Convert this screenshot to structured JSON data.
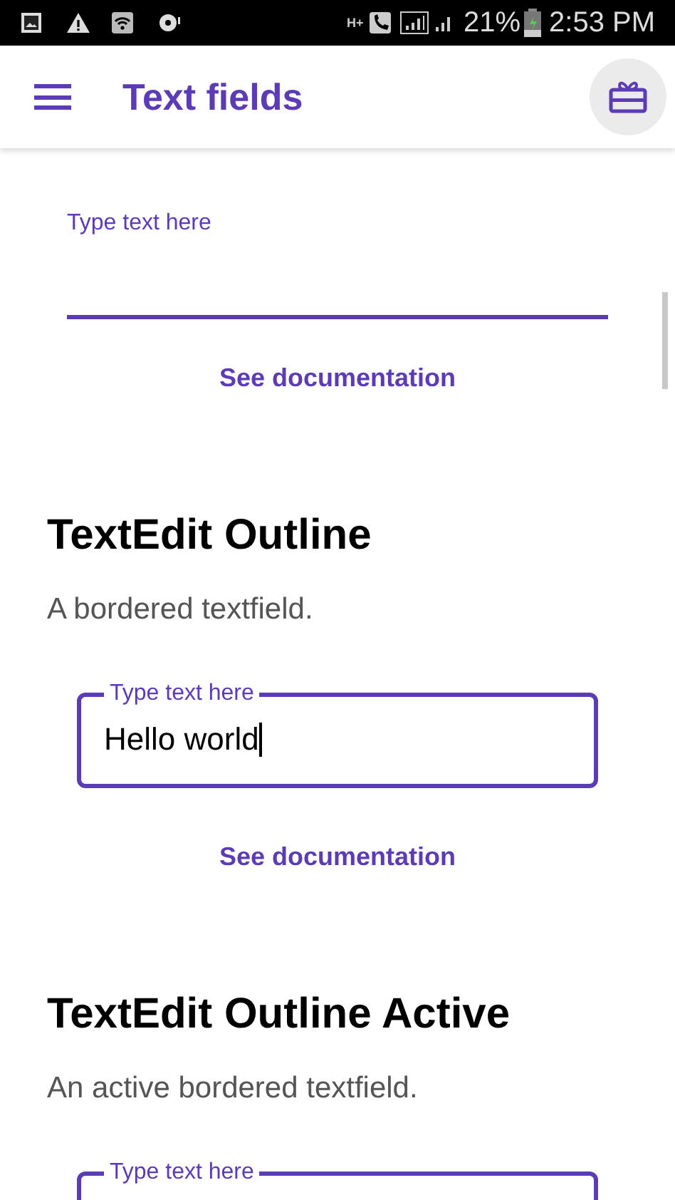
{
  "status_bar": {
    "network": "H+",
    "battery": "21%",
    "time": "2:53 PM"
  },
  "app_bar": {
    "title": "Text fields"
  },
  "sections": [
    {
      "kind": "underline",
      "field": {
        "label": "Type text here",
        "focused": false
      },
      "link": "See documentation"
    },
    {
      "kind": "outline",
      "heading": "TextEdit Outline",
      "description": "A bordered textfield.",
      "field": {
        "label": "Type text here",
        "value": "Hello world",
        "focused": true
      },
      "link": "See documentation"
    },
    {
      "kind": "outline",
      "heading": "TextEdit Outline Active",
      "description": "An active bordered textfield.",
      "field": {
        "label": "Type text here",
        "focused": false
      }
    }
  ]
}
